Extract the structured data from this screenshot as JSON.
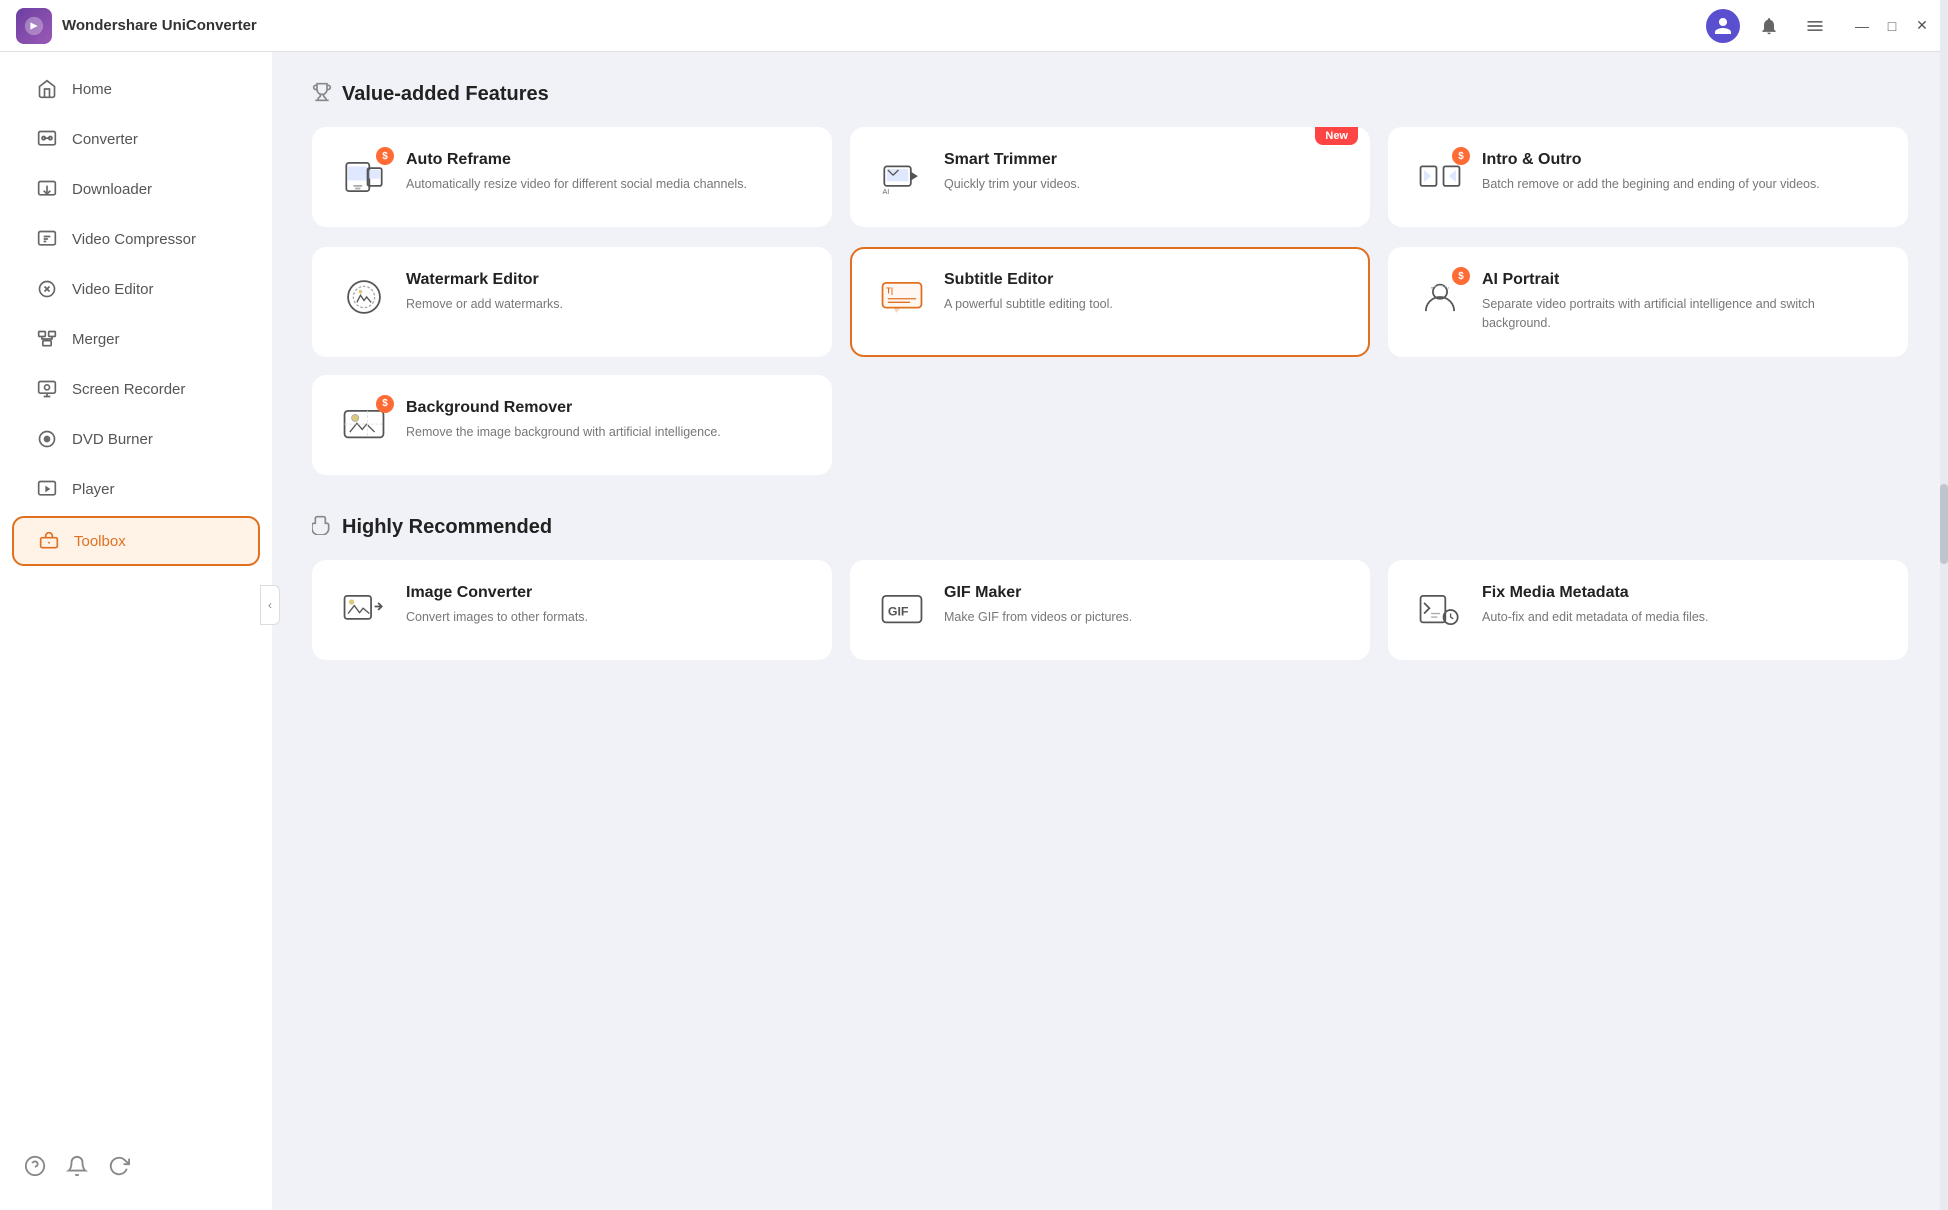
{
  "app": {
    "title": "Wondershare UniConverter",
    "logo_alt": "UniConverter Logo"
  },
  "titlebar": {
    "controls": {
      "minimize": "—",
      "maximize": "□",
      "close": "✕"
    }
  },
  "sidebar": {
    "items": [
      {
        "id": "home",
        "label": "Home",
        "icon": "home-icon"
      },
      {
        "id": "converter",
        "label": "Converter",
        "icon": "converter-icon"
      },
      {
        "id": "downloader",
        "label": "Downloader",
        "icon": "downloader-icon"
      },
      {
        "id": "video-compressor",
        "label": "Video Compressor",
        "icon": "compress-icon"
      },
      {
        "id": "video-editor",
        "label": "Video Editor",
        "icon": "edit-icon"
      },
      {
        "id": "merger",
        "label": "Merger",
        "icon": "merger-icon"
      },
      {
        "id": "screen-recorder",
        "label": "Screen Recorder",
        "icon": "screen-icon"
      },
      {
        "id": "dvd-burner",
        "label": "DVD Burner",
        "icon": "dvd-icon"
      },
      {
        "id": "player",
        "label": "Player",
        "icon": "player-icon"
      },
      {
        "id": "toolbox",
        "label": "Toolbox",
        "icon": "toolbox-icon",
        "active": true
      }
    ]
  },
  "main": {
    "value_added_section": {
      "title": "Value-added Features",
      "icon": "trophy-icon"
    },
    "highly_recommended_section": {
      "title": "Highly Recommended",
      "icon": "hand-icon"
    },
    "value_added_cards": [
      {
        "id": "auto-reframe",
        "title": "Auto Reframe",
        "description": "Automatically resize video for different social media channels.",
        "premium": true,
        "new": false,
        "active": false
      },
      {
        "id": "smart-trimmer",
        "title": "Smart Trimmer",
        "description": "Quickly trim your videos.",
        "premium": false,
        "new": true,
        "active": false
      },
      {
        "id": "intro-outro",
        "title": "Intro & Outro",
        "description": "Batch remove or add the begining and ending of your videos.",
        "premium": true,
        "new": false,
        "active": false
      },
      {
        "id": "watermark-editor",
        "title": "Watermark Editor",
        "description": "Remove or add watermarks.",
        "premium": false,
        "new": false,
        "active": false
      },
      {
        "id": "subtitle-editor",
        "title": "Subtitle Editor",
        "description": "A powerful subtitle editing tool.",
        "premium": false,
        "new": false,
        "active": true
      },
      {
        "id": "ai-portrait",
        "title": "AI Portrait",
        "description": "Separate video portraits with artificial intelligence and switch background.",
        "premium": true,
        "new": false,
        "active": false
      }
    ],
    "background_remover_card": {
      "id": "background-remover",
      "title": "Background Remover",
      "description": "Remove the image background with artificial intelligence.",
      "premium": true,
      "new": false
    },
    "recommended_cards": [
      {
        "id": "image-converter",
        "title": "Image Converter",
        "description": "Convert images to other formats.",
        "premium": false,
        "new": false
      },
      {
        "id": "gif-maker",
        "title": "GIF Maker",
        "description": "Make GIF from videos or pictures.",
        "premium": false,
        "new": false
      },
      {
        "id": "fix-media-metadata",
        "title": "Fix Media Metadata",
        "description": "Auto-fix and edit metadata of media files.",
        "premium": false,
        "new": false
      }
    ]
  }
}
